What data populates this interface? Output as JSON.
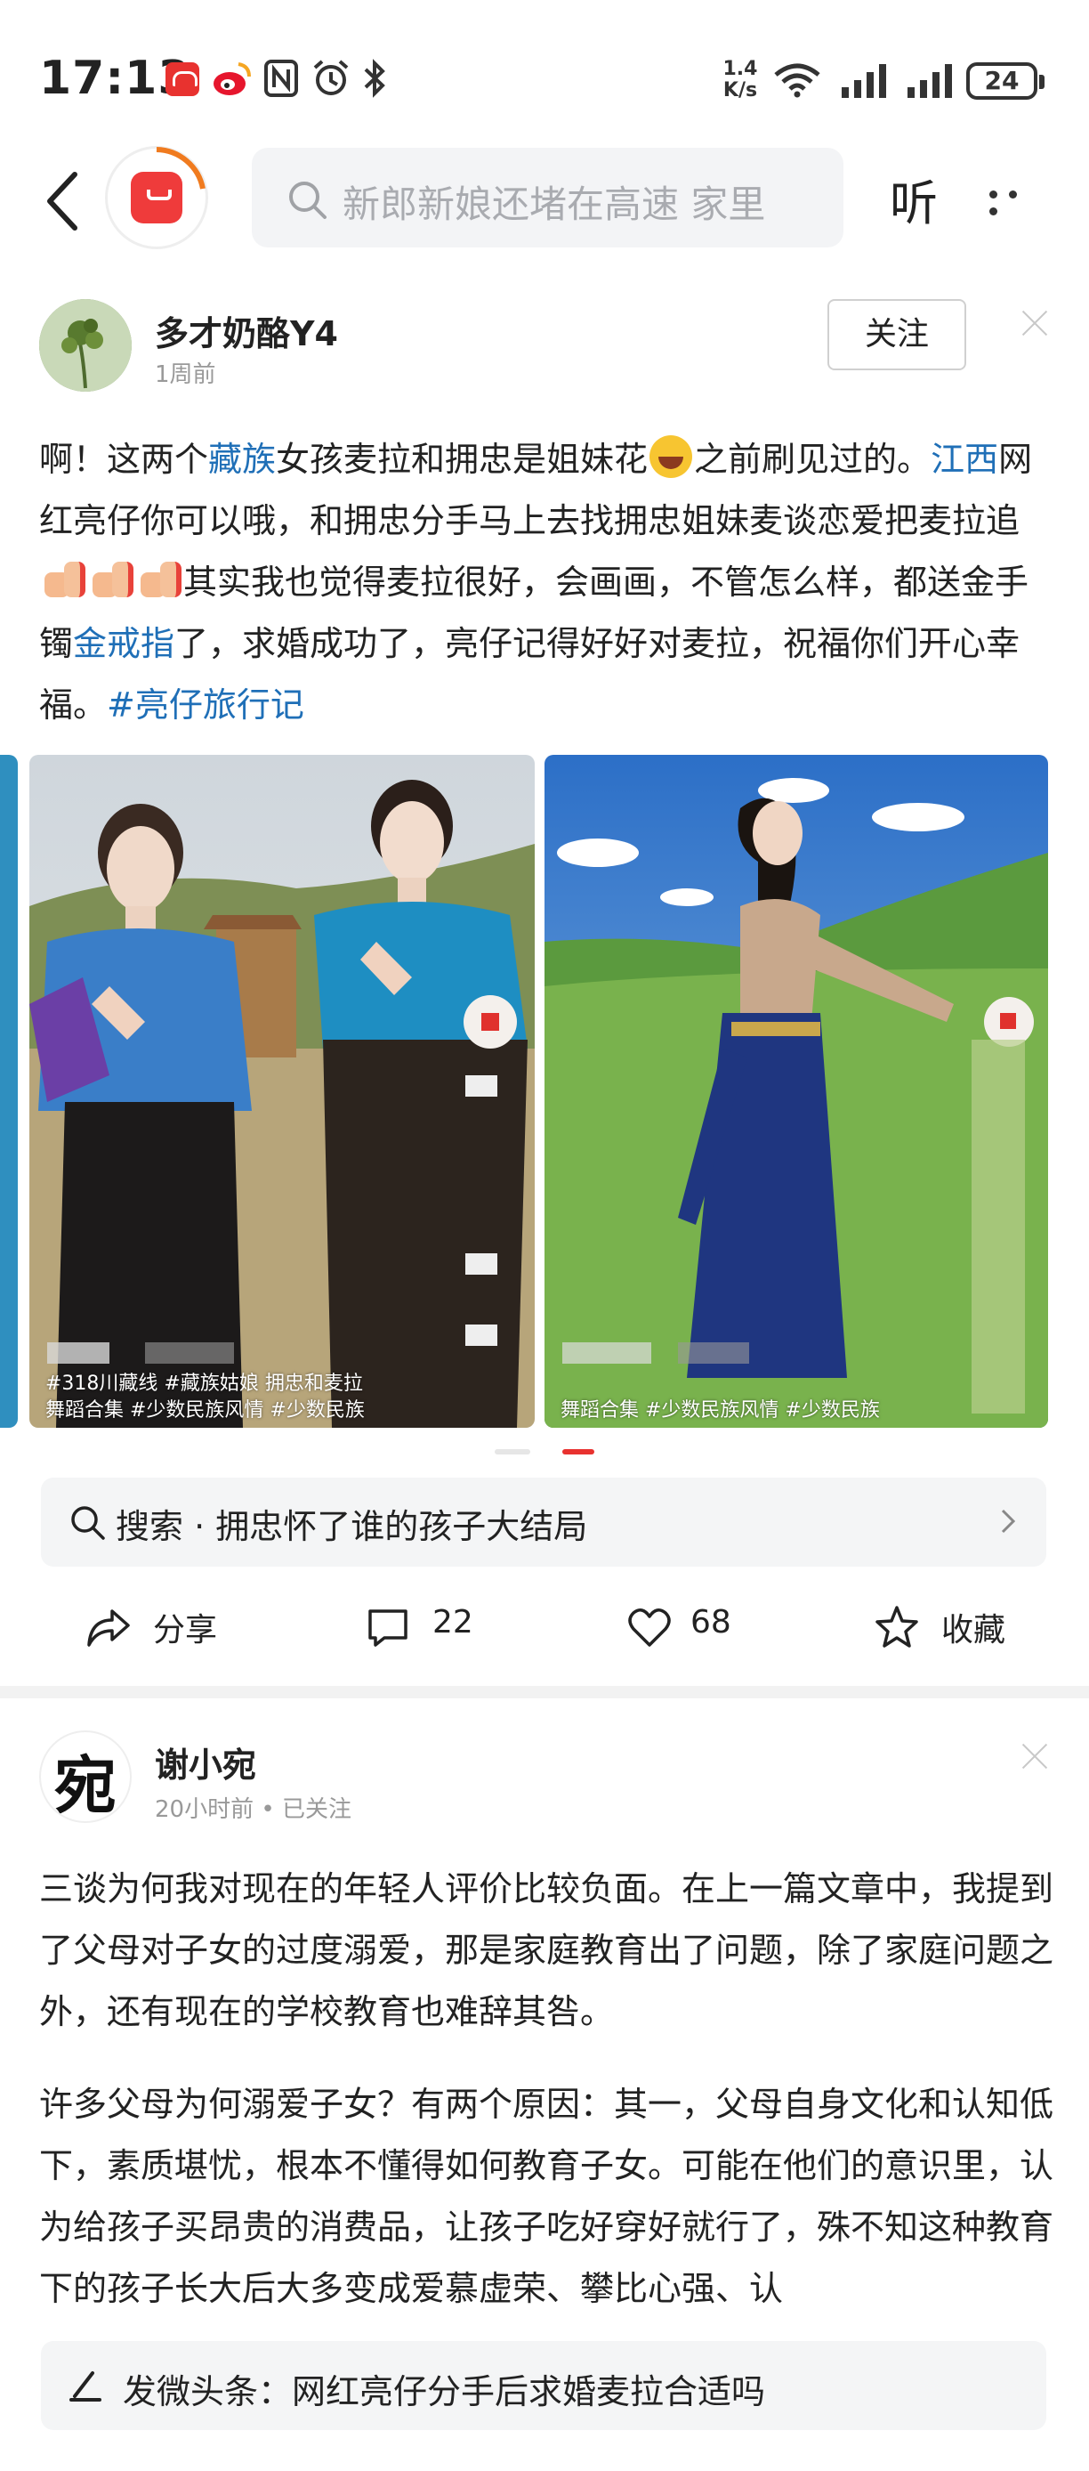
{
  "status_bar": {
    "time": "17:13",
    "net_speed_value": "1.4",
    "net_speed_unit": "K/s",
    "battery": "24"
  },
  "header": {
    "search_placeholder": "新郎新娘还堵在高速 家里",
    "listen_label": "听"
  },
  "post1": {
    "author": "多才奶酪Y4",
    "time_ago": "1周前",
    "follow_label": "关注",
    "text": {
      "s1": "啊！这两个",
      "tag1": "藏族",
      "s2": "女孩麦拉和拥忠是姐妹花",
      "s3": "之前刷见过的。",
      "tag2": "江西",
      "s4": "网红亮仔你可以哦，和拥忠分手马上去找拥忠姐妹麦谈恋爱把麦拉追",
      "s5": "其实我也觉得麦拉很好，会画画，不管怎么样，都送金手镯",
      "tag3": "金戒指",
      "s6": "了，求婚成功了，亮仔记得好好对麦拉，祝福你们开心幸福。",
      "tag4": "#亮仔旅行记"
    },
    "images": [
      {
        "caption_line1": "#318川藏线 #藏族姑娘 拥忠和麦拉",
        "caption_line2": "舞蹈合集 #少数民族风情 #少数民族"
      },
      {
        "caption_line1": "",
        "caption_line2": "舞蹈合集 #少数民族风情 #少数民族"
      }
    ],
    "related_search": {
      "prefix": "搜索",
      "dot": "·",
      "query": "拥忠怀了谁的孩子大结局"
    },
    "actions": {
      "share": "分享",
      "comments": "22",
      "likes": "68",
      "favorite": "收藏"
    }
  },
  "post2": {
    "author": "谢小宛",
    "avatar_char": "宛",
    "time_ago": "20小时前",
    "separator": "•",
    "follow_status": "已关注",
    "para1": "三谈为何我对现在的年轻人评价比较负面。在上一篇文章中，我提到了父母对子女的过度溺爱，那是家庭教育出了问题，除了家庭问题之外，还有现在的学校教育也难辞其咎。",
    "para2": "许多父母为何溺爱子女？有两个原因：其一，父母自身文化和认知低下，素质堪忧，根本不懂得如何教育子女。可能在他们的意识里，认为给孩子买昂贵的消费品，让孩子吃好穿好就行了，殊不知这种教育下的孩子长大后大多变成爱慕虚荣、攀比心强、认"
  },
  "bottom_bar": {
    "label": "发微头条：网红亮仔分手后求婚麦拉合适吗"
  },
  "colors": {
    "tag_blue": "#1f6fb7",
    "brand_red": "#e8322f"
  }
}
